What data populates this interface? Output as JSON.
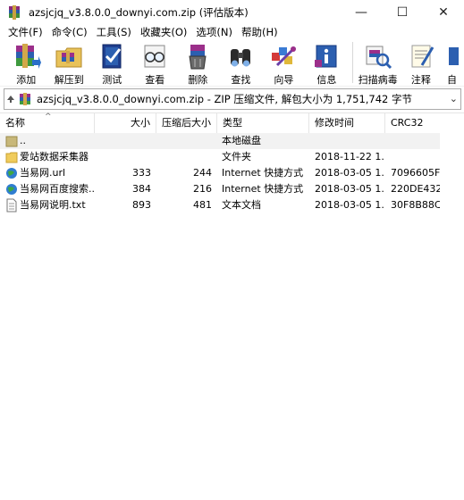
{
  "window": {
    "title": "azsjcjq_v3.8.0.0_downyi.com.zip (评估版本)",
    "controls": {
      "minimize": "—",
      "maximize": "☐",
      "close": "✕"
    }
  },
  "menubar": {
    "items": [
      "文件(F)",
      "命令(C)",
      "工具(S)",
      "收藏夹(O)",
      "选项(N)",
      "帮助(H)"
    ]
  },
  "toolbar": {
    "tools": [
      {
        "label": "添加",
        "icon": "add-books-icon"
      },
      {
        "label": "解压到",
        "icon": "extract-folder-icon"
      },
      {
        "label": "测试",
        "icon": "test-check-icon"
      },
      {
        "label": "查看",
        "icon": "view-glasses-icon"
      },
      {
        "label": "删除",
        "icon": "delete-trash-icon"
      },
      {
        "label": "查找",
        "icon": "find-binoculars-icon"
      },
      {
        "label": "向导",
        "icon": "wizard-icon"
      },
      {
        "label": "信息",
        "icon": "info-icon"
      },
      {
        "label": "扫描病毒",
        "icon": "virus-scan-icon"
      },
      {
        "label": "注释",
        "icon": "comment-icon"
      },
      {
        "label": "自",
        "icon": "sfx-icon"
      }
    ]
  },
  "address": {
    "text": "azsjcjq_v3.8.0.0_downyi.com.zip - ZIP 压缩文件, 解包大小为 1,751,742 字节"
  },
  "columns": {
    "name": "名称",
    "size": "大小",
    "packed": "压缩后大小",
    "type": "类型",
    "modified": "修改时间",
    "crc": "CRC32"
  },
  "rows": [
    {
      "name": "..",
      "size": "",
      "packed": "",
      "type": "本地磁盘",
      "modified": "",
      "crc": "",
      "icon": "parent-folder-icon"
    },
    {
      "name": "爱站数据采集器",
      "size": "",
      "packed": "",
      "type": "文件夹",
      "modified": "2018-11-22 1...",
      "crc": "",
      "icon": "folder-icon"
    },
    {
      "name": "当易网.url",
      "size": "333",
      "packed": "244",
      "type": "Internet 快捷方式",
      "modified": "2018-03-05 1...",
      "crc": "7096605F",
      "icon": "globe-icon"
    },
    {
      "name": "当易网百度搜索....",
      "size": "384",
      "packed": "216",
      "type": "Internet 快捷方式",
      "modified": "2018-03-05 1...",
      "crc": "220DE432",
      "icon": "globe-icon"
    },
    {
      "name": "当易网说明.txt",
      "size": "893",
      "packed": "481",
      "type": "文本文档",
      "modified": "2018-03-05 1...",
      "crc": "30F8B88C",
      "icon": "text-file-icon"
    }
  ]
}
